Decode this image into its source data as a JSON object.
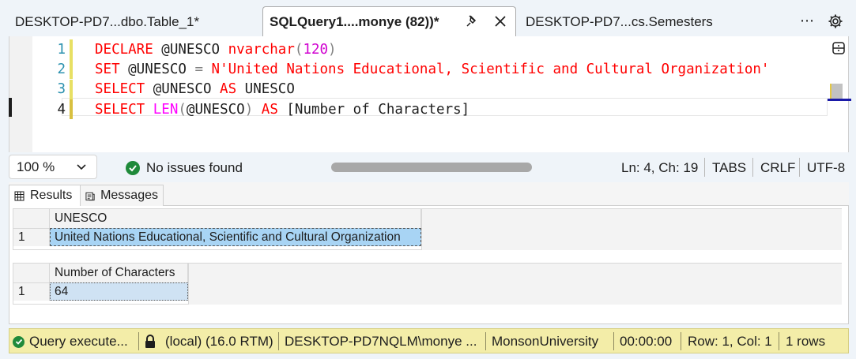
{
  "tabs": [
    {
      "label": "DESKTOP-PD7...dbo.Table_1*",
      "active": false
    },
    {
      "label": "SQLQuery1....monye (82))*",
      "active": true
    },
    {
      "label": "DESKTOP-PD7...cs.Semesters",
      "active": false
    }
  ],
  "tab_icons": {
    "pin": "pin-icon",
    "close": "close-icon",
    "more": "more-icon",
    "settings": "gear-icon"
  },
  "tab_more_label": "⋯",
  "editor": {
    "line_numbers": [
      "1",
      "2",
      "3",
      "4"
    ],
    "lines": [
      {
        "tokens": [
          {
            "t": "DECLARE",
            "c": "k"
          },
          {
            "t": " @UNESCO ",
            "c": "b"
          },
          {
            "t": "nvarchar",
            "c": "k"
          },
          {
            "t": "(",
            "c": "g"
          },
          {
            "t": "120",
            "c": "n"
          },
          {
            "t": ")",
            "c": "g"
          }
        ]
      },
      {
        "tokens": [
          {
            "t": "SET",
            "c": "k"
          },
          {
            "t": " @UNESCO ",
            "c": "b"
          },
          {
            "t": "=",
            "c": "g"
          },
          {
            "t": " ",
            "c": "b"
          },
          {
            "t": "N'United Nations Educational, Scientific and Cultural Organization'",
            "c": "s"
          }
        ]
      },
      {
        "tokens": [
          {
            "t": "SELECT",
            "c": "k"
          },
          {
            "t": " @UNESCO ",
            "c": "b"
          },
          {
            "t": "AS",
            "c": "k"
          },
          {
            "t": " UNESCO",
            "c": "b"
          }
        ]
      },
      {
        "tokens": [
          {
            "t": "SELECT",
            "c": "k"
          },
          {
            "t": " ",
            "c": "b"
          },
          {
            "t": "LEN",
            "c": "f"
          },
          {
            "t": "(",
            "c": "g"
          },
          {
            "t": "@UNESCO",
            "c": "b"
          },
          {
            "t": ")",
            "c": "g"
          },
          {
            "t": " ",
            "c": "b"
          },
          {
            "t": "AS",
            "c": "k"
          },
          {
            "t": " [Number of Characters]",
            "c": "b"
          }
        ]
      }
    ]
  },
  "editor_status": {
    "zoom": "100 %",
    "issues": "No issues found",
    "position": "Ln: 4, Ch: 19",
    "indent": "TABS",
    "line_ending": "CRLF",
    "encoding": "UTF-8"
  },
  "results_tabs": {
    "results": "Results",
    "messages": "Messages"
  },
  "grids": [
    {
      "column": "UNESCO",
      "rows": [
        {
          "num": "1",
          "value": "United Nations Educational, Scientific and Cultural Organization"
        }
      ]
    },
    {
      "column": "Number of Characters",
      "rows": [
        {
          "num": "1",
          "value": "64"
        }
      ]
    }
  ],
  "status_bar": {
    "query": "Query  execute...",
    "server": "(local) (16.0 RTM)",
    "user": "DESKTOP-PD7NQLM\\monye ...",
    "database": "MonsonUniversity",
    "time": "00:00:00",
    "rowcol": "Row: 1, Col: 1",
    "rows": "1 rows"
  },
  "colors": {
    "keyword": "#ff0000",
    "string": "#ff0000",
    "number": "#d000d0",
    "function": "#ff00ff",
    "statusbar": "#f3eda8",
    "ok": "#1f8a3a"
  }
}
